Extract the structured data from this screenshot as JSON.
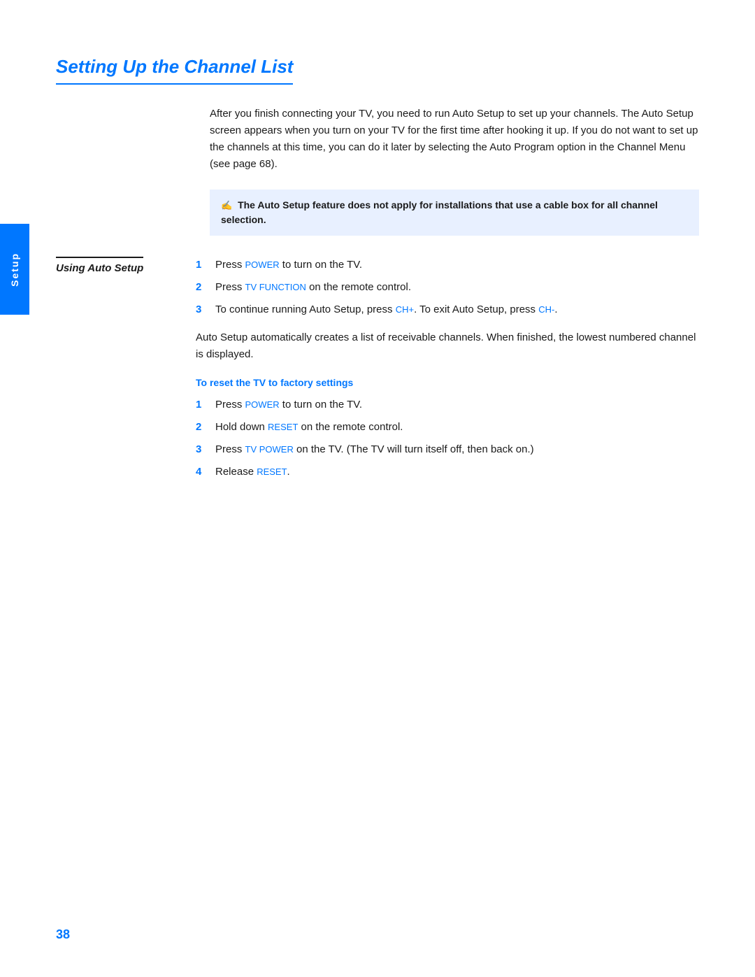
{
  "page": {
    "number": "38",
    "sidebar_label": "Setup"
  },
  "title": "Setting Up the Channel List",
  "intro": {
    "text": "After you finish connecting your TV, you need to run Auto Setup to set up your channels. The Auto Setup screen appears when you turn on your TV for the first time after hooking it up. If you do not want to set up the channels at this time, you can do it later by selecting the Auto Program option in the Channel Menu (see page 68)."
  },
  "note": {
    "icon": "✍",
    "text": "The Auto Setup feature does not apply for installations that use a cable box for all channel selection."
  },
  "section_label": "Using Auto Setup",
  "auto_setup_steps": [
    {
      "number": "1",
      "text_before": "Press ",
      "keyword": "POWER",
      "text_after": " to turn on the TV."
    },
    {
      "number": "2",
      "text_before": "Press ",
      "keyword": "TV FUNCTION",
      "text_after": " on the remote control."
    },
    {
      "number": "3",
      "text_before": "To continue running Auto Setup, press ",
      "keyword1": "CH+",
      "text_middle": ". To exit Auto Setup, press ",
      "keyword2": "CH-",
      "text_after": "."
    }
  ],
  "auto_setup_para": "Auto Setup automatically creates a list of receivable channels. When finished, the lowest numbered channel is displayed.",
  "reset_heading": "To reset the TV to factory settings",
  "reset_steps": [
    {
      "number": "1",
      "text_before": "Press ",
      "keyword": "POWER",
      "text_after": " to turn on the TV."
    },
    {
      "number": "2",
      "text_before": "Hold down ",
      "keyword": "RESET",
      "text_after": " on the remote control."
    },
    {
      "number": "3",
      "text_before": "Press ",
      "keyword": "TV POWER",
      "text_after": " on the TV. (The TV will turn itself off, then back on.)"
    },
    {
      "number": "4",
      "text_before": "Release ",
      "keyword": "RESET",
      "text_after": "."
    }
  ]
}
